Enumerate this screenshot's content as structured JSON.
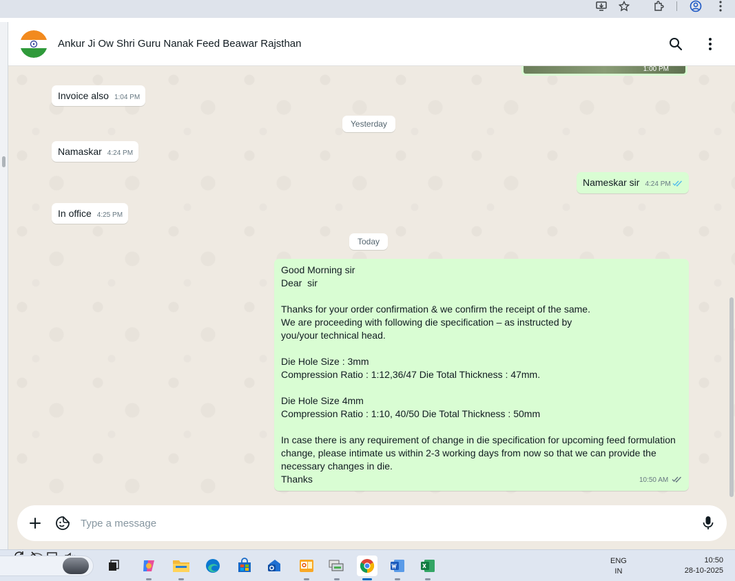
{
  "chat": {
    "title": "Ankur Ji Ow Shri Guru Nanak Feed Beawar Rajsthan"
  },
  "messages": {
    "top_image_time": "1:00 PM",
    "m1": {
      "text": "Invoice also",
      "time": "1:04 PM"
    },
    "day1": "Yesterday",
    "m2": {
      "text": "Namaskar",
      "time": "4:24 PM"
    },
    "m3": {
      "text": "Nameskar sir",
      "time": "4:24 PM"
    },
    "m4": {
      "text": "In office",
      "time": "4:25 PM"
    },
    "day2": "Today",
    "m5": {
      "lines": [
        "Good Morning sir",
        "Dear  sir",
        "",
        "Thanks for your order confirmation & we confirm the receipt of the same.",
        "We are proceeding with following die specification – as instructed by",
        "you/your technical head.",
        "",
        "Die Hole Size : 3mm",
        "Compression Ratio : 1:12,36/47 Die Total Thickness : 47mm.",
        "",
        "Die Hole Size 4mm",
        "Compression Ratio : 1:10, 40/50 Die Total Thickness : 50mm",
        "",
        "In case there is any requirement of change in die specification for upcoming feed formulation",
        "change, please intimate us within 2-3 working days from now so that we can provide the",
        "necessary changes in die.",
        "Thanks"
      ],
      "time": "10:50 AM"
    }
  },
  "composer": {
    "placeholder": "Type a message"
  },
  "taskbar": {
    "lang_line1": "ENG",
    "lang_line2": "IN",
    "time": "10:50",
    "date": "28-10-2025"
  },
  "colors": {
    "outgoing_bubble": "#d9fdd3",
    "incoming_bubble": "#ffffff",
    "chat_background": "#efeae2",
    "read_tick": "#53bdeb"
  }
}
